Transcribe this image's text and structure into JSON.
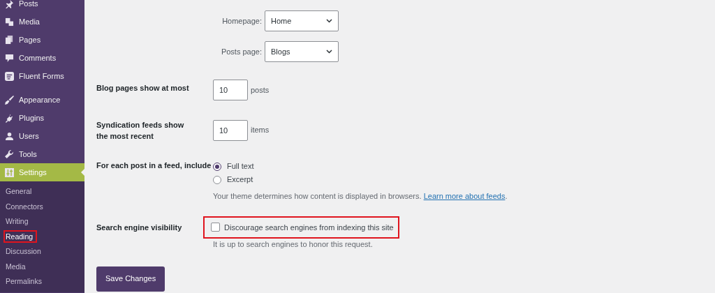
{
  "sidebar": {
    "menu_groups": [
      [
        {
          "label": "Posts",
          "selected": false
        },
        {
          "label": "Media",
          "selected": false
        },
        {
          "label": "Pages",
          "selected": false
        },
        {
          "label": "Comments",
          "selected": false
        },
        {
          "label": "Fluent Forms",
          "selected": false
        }
      ],
      [
        {
          "label": "Appearance",
          "selected": false
        },
        {
          "label": "Plugins",
          "selected": false
        },
        {
          "label": "Users",
          "selected": false
        },
        {
          "label": "Tools",
          "selected": false
        },
        {
          "label": "Settings",
          "selected": true
        }
      ]
    ],
    "submenu": [
      {
        "label": "General",
        "selected": false,
        "highlighted": false
      },
      {
        "label": "Connectors",
        "selected": false,
        "highlighted": false
      },
      {
        "label": "Writing",
        "selected": false,
        "highlighted": false
      },
      {
        "label": "Reading",
        "selected": true,
        "highlighted": true
      },
      {
        "label": "Discussion",
        "selected": false,
        "highlighted": false
      },
      {
        "label": "Media",
        "selected": false,
        "highlighted": false
      },
      {
        "label": "Permalinks",
        "selected": false,
        "highlighted": false
      }
    ]
  },
  "front_page": [
    {
      "label": "Homepage:",
      "value": "Home"
    },
    {
      "label": "Posts page:",
      "value": "Blogs"
    }
  ],
  "number_settings": [
    {
      "label": "Blog pages show at most",
      "value": "10",
      "unit": "posts"
    },
    {
      "label": "Syndication feeds show the most recent",
      "value": "10",
      "unit": "items"
    }
  ],
  "feed_content": {
    "label": "For each post in a feed, include",
    "options": [
      {
        "label": "Full text",
        "selected": true
      },
      {
        "label": "Excerpt",
        "selected": false
      }
    ],
    "description": "Your theme determines how content is displayed in browsers.",
    "link": "Learn more about feeds",
    "after_link": "."
  },
  "search_visibility": {
    "label": "Search engine visibility",
    "checkbox": "Discourage search engines from indexing this site",
    "checked": false,
    "highlighted": true,
    "note": "It is up to search engines to honor this request."
  },
  "save_button": "Save Changes"
}
